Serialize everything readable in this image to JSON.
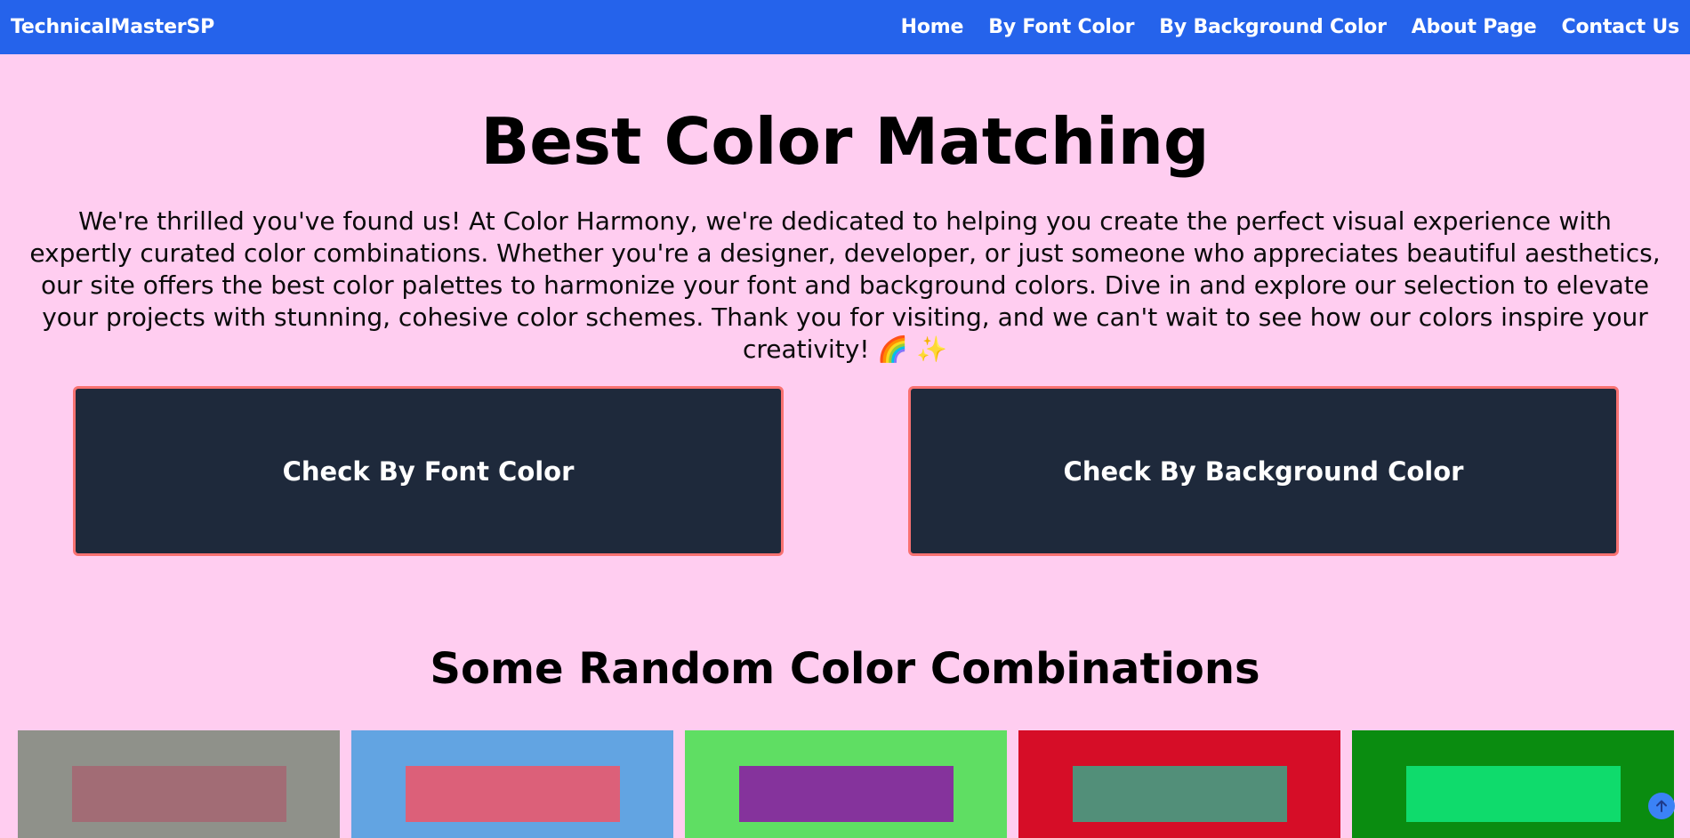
{
  "header": {
    "brand": "TechnicalMasterSP",
    "nav": [
      {
        "label": "Home"
      },
      {
        "label": "By Font Color"
      },
      {
        "label": "By Background Color"
      },
      {
        "label": "About Page"
      },
      {
        "label": "Contact Us"
      }
    ]
  },
  "hero": {
    "title": "Best Color Matching",
    "intro": "We're thrilled you've found us! At Color Harmony, we're dedicated to helping you create the perfect visual experience with expertly curated color combinations. Whether you're a designer, developer, or just someone who appreciates beautiful aesthetics, our site offers the best color palettes to harmonize your font and background colors. Dive in and explore our selection to elevate your projects with stunning, cohesive color schemes. Thank you for visiting, and we can't wait to see how our colors inspire your creativity! 🌈 ✨"
  },
  "cta": {
    "font_label": "Check By Font Color",
    "background_label": "Check By Background Color"
  },
  "random": {
    "title": "Some Random Color Combinations",
    "swatches": [
      {
        "background": "#8f918a",
        "foreground": "#a26c75"
      },
      {
        "background": "#62a4e2",
        "foreground": "#dc6079"
      },
      {
        "background": "#5fde63",
        "foreground": "#85339c"
      },
      {
        "background": "#d60d27",
        "foreground": "#528f79"
      },
      {
        "background": "#0a8c10",
        "foreground": "#0fdb6c"
      }
    ]
  },
  "scroll_top": {
    "icon": "arrow-up-icon"
  },
  "colors": {
    "page_bg": "#ffcdf0",
    "header_bg": "#2563eb",
    "button_bg": "#1e293b",
    "button_border": "#f87171",
    "scroll_button": "#3b82f6"
  }
}
